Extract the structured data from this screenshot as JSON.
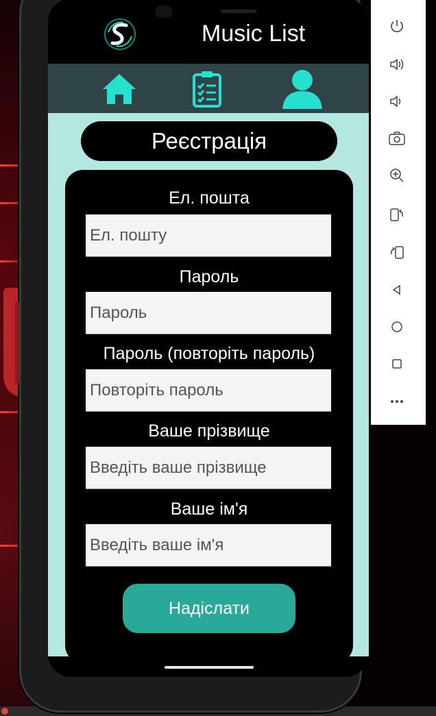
{
  "app": {
    "title": "Music List"
  },
  "nav": {
    "items": [
      {
        "icon": "home-icon"
      },
      {
        "icon": "clipboard-list-icon"
      },
      {
        "icon": "user-icon"
      }
    ]
  },
  "page": {
    "title": "Реєстрація"
  },
  "form": {
    "email_label": "Ел. пошта",
    "email_placeholder": "Ел. пошту",
    "password_label": "Пароль",
    "password_placeholder": "Пароль",
    "confirm_label": "Пароль (повторіть пароль)",
    "confirm_placeholder": "Повторіть пароль",
    "surname_label": "Ваше прізвище",
    "surname_placeholder": "Введіть ваше прізвище",
    "name_label": "Ваше ім'я",
    "name_placeholder": "Введіть ваше ім'я",
    "submit_label": "Надіслати"
  },
  "emulator_toolbar": {
    "tools": [
      "power-icon",
      "volume-up-icon",
      "volume-down-icon",
      "camera-icon",
      "zoom-in-icon",
      "rotate-left-icon",
      "rotate-right-icon",
      "back-icon",
      "home-circle-icon",
      "overview-icon",
      "more-icon"
    ]
  },
  "colors": {
    "accent_teal": "#28e0d0",
    "content_bg": "#b3e7df",
    "nav_bg": "#2f4447",
    "submit_bg": "#2aa89a"
  }
}
